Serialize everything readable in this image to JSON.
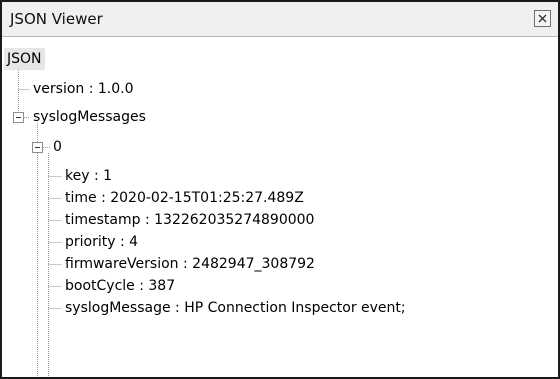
{
  "window": {
    "title": "JSON Viewer"
  },
  "tree": {
    "root_label": "JSON",
    "version": "version : 1.0.0",
    "syslog_messages": "syslogMessages",
    "item_index": "0",
    "fields": [
      "key : 1",
      "time : 2020-02-15T01:25:27.489Z",
      "timestamp : 132262035274890000",
      "priority : 4",
      "firmwareVersion : 2482947_308792",
      "bootCycle : 387",
      "syslogMessage : HP Connection Inspector event;"
    ]
  },
  "icons": {
    "close": "close-icon",
    "collapse": "minus-box-icon"
  },
  "colors": {
    "titlebar_bg": "#f0f0f0",
    "selected_bg": "#e6e6e6",
    "connector_lines": "#9a9a9a",
    "window_border": "#1a1a1a"
  }
}
